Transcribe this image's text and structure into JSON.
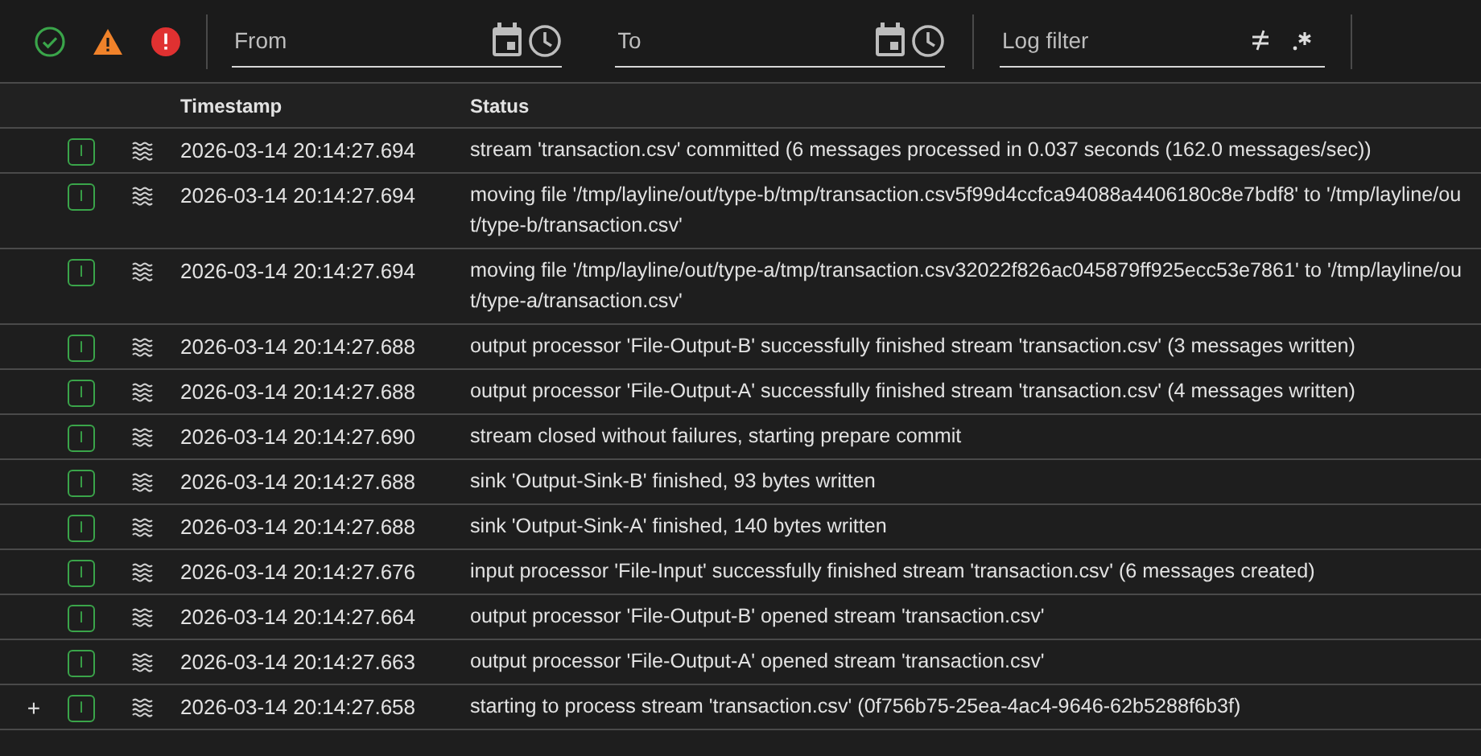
{
  "toolbar": {
    "severity_filters": [
      {
        "kind": "success"
      },
      {
        "kind": "warning"
      },
      {
        "kind": "error"
      }
    ],
    "from": {
      "placeholder": "From"
    },
    "to": {
      "placeholder": "To"
    },
    "log_filter": {
      "placeholder": "Log filter"
    }
  },
  "table": {
    "columns": [
      "Timestamp",
      "Status"
    ],
    "rows": [
      {
        "level": "I",
        "timestamp": "2026-03-14 20:14:27.694",
        "status": "stream 'transaction.csv' committed (6 messages processed in 0.037 seconds (162.0 messages/sec))"
      },
      {
        "level": "I",
        "timestamp": "2026-03-14 20:14:27.694",
        "status": "moving file '/tmp/layline/out/type-b/tmp/transaction.csv5f99d4ccfca94088a4406180c8e7bdf8' to '/tmp/layline/out/type-b/transaction.csv'"
      },
      {
        "level": "I",
        "timestamp": "2026-03-14 20:14:27.694",
        "status": "moving file '/tmp/layline/out/type-a/tmp/transaction.csv32022f826ac045879ff925ecc53e7861' to '/tmp/layline/out/type-a/transaction.csv'"
      },
      {
        "level": "I",
        "timestamp": "2026-03-14 20:14:27.688",
        "status": "output processor 'File-Output-B' successfully finished stream 'transaction.csv' (3 messages written)"
      },
      {
        "level": "I",
        "timestamp": "2026-03-14 20:14:27.688",
        "status": "output processor 'File-Output-A' successfully finished stream 'transaction.csv' (4 messages written)"
      },
      {
        "level": "I",
        "timestamp": "2026-03-14 20:14:27.690",
        "status": "stream closed without failures, starting prepare commit"
      },
      {
        "level": "I",
        "timestamp": "2026-03-14 20:14:27.688",
        "status": "sink 'Output-Sink-B' finished, 93 bytes written"
      },
      {
        "level": "I",
        "timestamp": "2026-03-14 20:14:27.688",
        "status": "sink 'Output-Sink-A' finished, 140 bytes written"
      },
      {
        "level": "I",
        "timestamp": "2026-03-14 20:14:27.676",
        "status": "input processor 'File-Input' successfully finished stream 'transaction.csv' (6 messages created)"
      },
      {
        "level": "I",
        "timestamp": "2026-03-14 20:14:27.664",
        "status": "output processor 'File-Output-B' opened stream 'transaction.csv'"
      },
      {
        "level": "I",
        "timestamp": "2026-03-14 20:14:27.663",
        "status": "output processor 'File-Output-A' opened stream 'transaction.csv'"
      },
      {
        "level": "I",
        "timestamp": "2026-03-14 20:14:27.658",
        "status": "starting to process stream 'transaction.csv' (0f756b75-25ea-4ac4-9646-62b5288f6b3f)",
        "toggle": "+"
      }
    ]
  }
}
